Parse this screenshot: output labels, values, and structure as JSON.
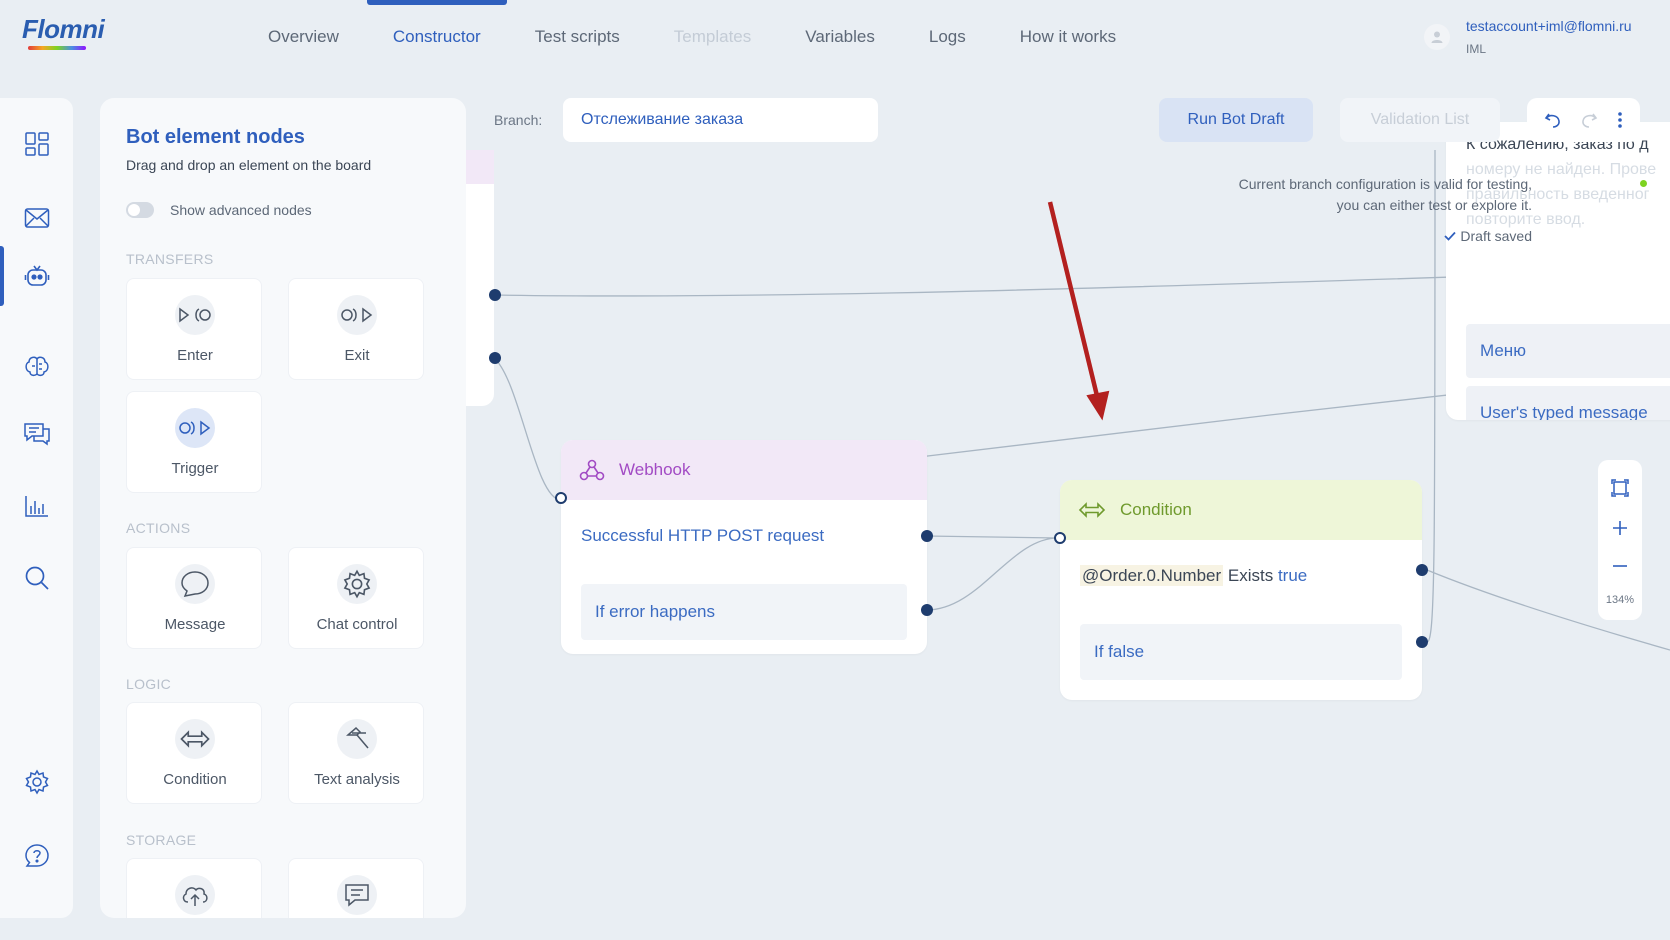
{
  "app": {
    "logo_text": "Flomni"
  },
  "nav": {
    "items": [
      {
        "label": "Overview"
      },
      {
        "label": "Constructor"
      },
      {
        "label": "Test scripts"
      },
      {
        "label": "Templates"
      },
      {
        "label": "Variables"
      },
      {
        "label": "Logs"
      },
      {
        "label": "How it works"
      }
    ],
    "active": "Constructor",
    "disabled": "Templates"
  },
  "account": {
    "email": "testaccount+iml@flomni.ru",
    "org": "IML"
  },
  "rail": {
    "icons": [
      "dashboard-icon",
      "mail-icon",
      "bot-icon",
      "brain-icon",
      "chat-icon",
      "analytics-icon",
      "search-icon",
      "settings-icon",
      "help-icon"
    ],
    "active": "bot-icon"
  },
  "palette": {
    "title": "Bot element nodes",
    "subtitle": "Drag and drop an element on the board",
    "advanced_toggle_label": "Show advanced nodes",
    "sections": {
      "transfers": "TRANSFERS",
      "actions": "ACTIONS",
      "logic": "LOGIC",
      "storage": "STORAGE"
    },
    "nodes": {
      "enter": "Enter",
      "exit": "Exit",
      "trigger": "Trigger",
      "message": "Message",
      "chat_control": "Chat control",
      "condition": "Condition",
      "text_analysis": "Text analysis"
    }
  },
  "toolbar": {
    "branch_label": "Branch:",
    "branch_value": "Отслеживание заказа",
    "run_label": "Run Bot Draft",
    "validation_label": "Validation List"
  },
  "status": {
    "valid_line1": "Current branch configuration is valid for testing,",
    "valid_line2": "you can either test or explore it.",
    "draft_saved": "Draft saved",
    "ok_color": "#7ed321"
  },
  "canvas": {
    "webhook": {
      "title": "Webhook",
      "row1": "Successful HTTP POST request",
      "row2": "If error happens"
    },
    "condition": {
      "title": "Condition",
      "variable": "@Order.0.Number",
      "operator": "Exists",
      "value": "true",
      "else": "If false"
    },
    "message_node": {
      "text_line1": "К сожалению, заказ по д",
      "text_line2": "номеру не найден. Прове",
      "text_line3": "правильность введенног",
      "text_line4": "повторите ввод.",
      "button1": "Меню",
      "button2": "User's typed message"
    },
    "zoom": "134%"
  },
  "colors": {
    "accent": "#2f5fbd",
    "webhook_header": "#f2e8f7",
    "webhook_text": "#a24bc4",
    "condition_header": "#eef6d8",
    "condition_text": "#6f9a2d",
    "arrow": "#b3201f"
  }
}
